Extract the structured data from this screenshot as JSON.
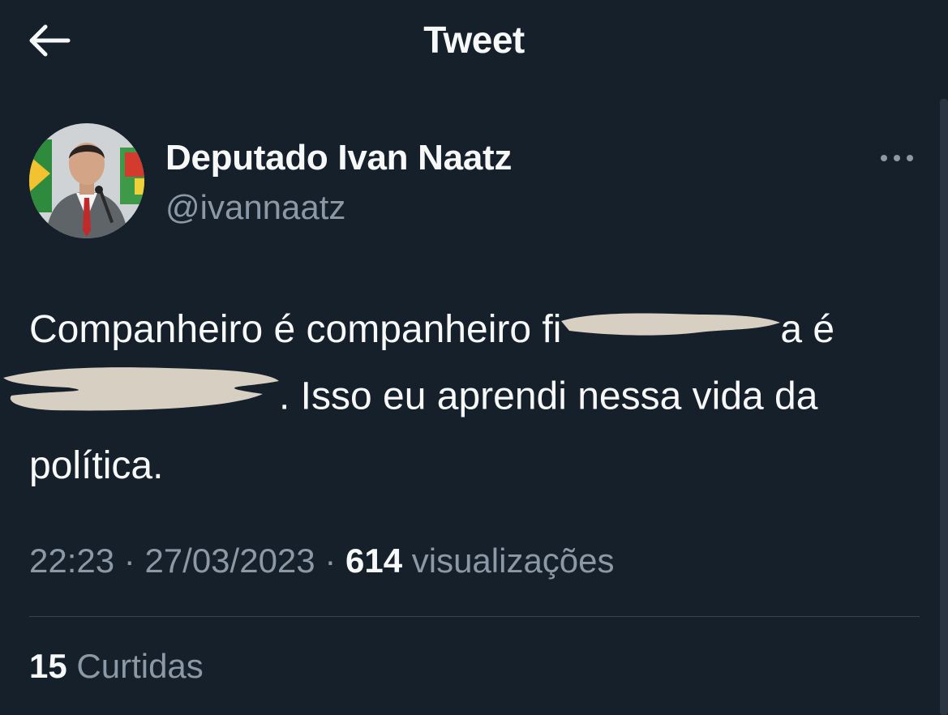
{
  "header": {
    "title": "Tweet",
    "back_icon": "arrow-left-icon"
  },
  "author": {
    "display_name": "Deputado Ivan Naatz",
    "handle": "@ivannaatz",
    "avatar_icon": "avatar-photo",
    "more_icon": "more-options-icon"
  },
  "tweet": {
    "line1_start": "Companheiro é companheiro fi",
    "line1_end": "a é",
    "line2_end": ". Isso eu aprendi nessa vida da",
    "line3": "política."
  },
  "meta": {
    "time": "22:23",
    "sep1": " · ",
    "date": "27/03/2023",
    "sep2": " · ",
    "views_count": "614",
    "views_label": " visualizações"
  },
  "stats": {
    "likes_count": "15",
    "likes_label": " Curtidas"
  },
  "colors": {
    "background": "#16202b",
    "text_primary": "#f7f9f9",
    "text_secondary": "#8b98a5",
    "divider": "#38444d",
    "redaction": "#d8cfc3"
  }
}
